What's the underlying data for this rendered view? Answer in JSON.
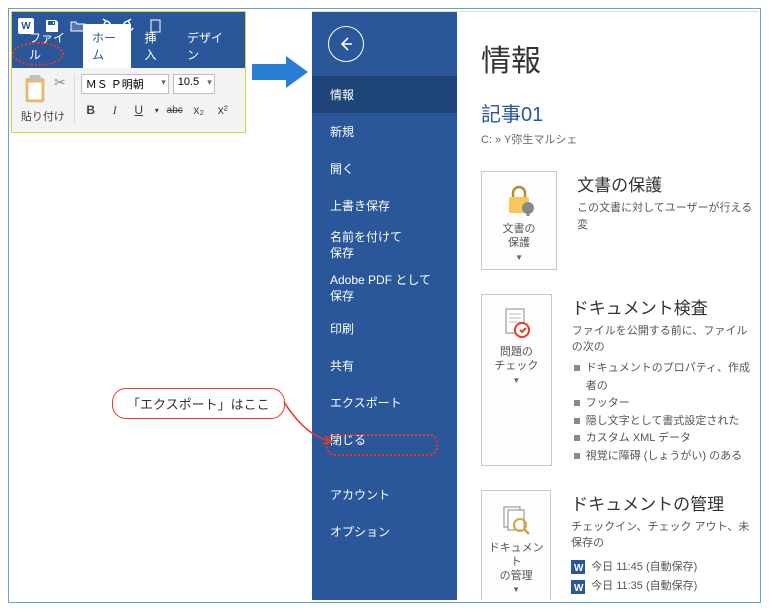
{
  "ribbon": {
    "tabs": {
      "file": "ファイル",
      "home": "ホーム",
      "insert": "挿入",
      "design": "デザイン"
    },
    "paste_label": "貼り付け",
    "font_name": "ＭＳ Ｐ明朝",
    "font_size": "10.5",
    "bold": "B",
    "italic": "I",
    "underline": "U",
    "strike": "abc",
    "sub": "x₂",
    "sup": "x²"
  },
  "backstage": {
    "items": {
      "info": "情報",
      "new": "新規",
      "open": "開く",
      "save": "上書き保存",
      "saveas": "名前を付けて\n保存",
      "pdf": "Adobe PDF として\n保存",
      "print": "印刷",
      "share": "共有",
      "export": "エクスポート",
      "close": "閉じる",
      "account": "アカウント",
      "options": "オプション"
    }
  },
  "main": {
    "title": "情報",
    "doc_title": "記事01",
    "breadcrumb": "C: » Y弥生マルシェ",
    "protect": {
      "btn": "文書の\n保護",
      "heading": "文書の保護",
      "text": "この文書に対してユーザーが行える変"
    },
    "inspect": {
      "btn": "問題の\nチェック",
      "heading": "ドキュメント検査",
      "text": "ファイルを公開する前に、ファイルの次の",
      "bullets": [
        "ドキュメントのプロパティ、作成者の",
        "フッター",
        "隠し文字として書式設定された",
        "カスタム XML データ",
        "視覚に障碍 (しょうがい) のある"
      ]
    },
    "manage": {
      "btn": "ドキュメント\nの管理",
      "heading": "ドキュメントの管理",
      "text": "チェックイン、チェック アウト、未保存の",
      "versions": [
        "今日 11:45 (自動保存)",
        "今日 11:35 (自動保存)"
      ]
    }
  },
  "callout": {
    "text": "「エクスポート」はここ"
  }
}
